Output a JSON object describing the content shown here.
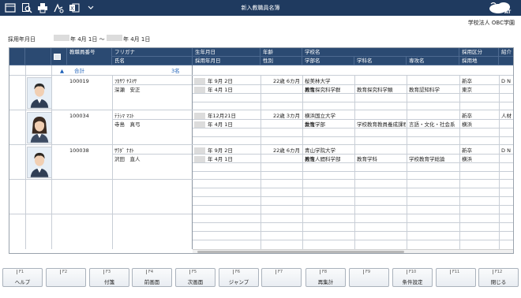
{
  "window": {
    "title": "新入教職員名簿",
    "company": "学校法人 OBC学園",
    "logo_text": "AT"
  },
  "toolbar": {
    "icons": [
      "window-icon",
      "search-icon",
      "printer-icon",
      "pdf-icon",
      "excel-icon",
      "dropdown-icon"
    ]
  },
  "filter": {
    "label": "採用年月日",
    "from_suffix": "年 4月 1日 ～",
    "to_suffix": "年 4月 1日"
  },
  "grid": {
    "headers_top": {
      "employee_no": "教職員番号",
      "furigana": "フリガナ",
      "birth": "生年月日",
      "age": "年齢",
      "school": "学校名",
      "hire_type": "採用区分",
      "intro": "紹介"
    },
    "headers_bottom": {
      "name": "氏名",
      "hire_date": "採用年月日",
      "gender": "性別",
      "faculty": "学部名",
      "department": "学科名",
      "major": "専攻名",
      "hire_place": "採用地"
    },
    "summary": {
      "label": "合計",
      "count": "3名"
    },
    "rows": [
      {
        "no": "100019",
        "kana": "ﾌｶｻﾜ ﾔｽﾏｻ",
        "name": "深瀬　安正",
        "birth": "年  9月  2日",
        "age": "22歳  6カ月",
        "school": "桜美林大学",
        "hire_type": "新卒",
        "intro": "D N",
        "hire_date": "年  4月  1日",
        "gender": "男性",
        "faculty": "教育探究科学群",
        "department": "教育探究科学類",
        "major": "教育認知科学",
        "place": "東京"
      },
      {
        "no": "100034",
        "kana": "ﾃﾗｼﾏ ﾏｺﾄ",
        "name": "寺島　真弓",
        "birth": "年12月21日",
        "age": "22歳  3カ月",
        "school": "横浜国立大学",
        "hire_type": "新卒",
        "intro": "人材",
        "hire_date": "年  4月  1日",
        "gender": "女性",
        "faculty": "教育学部",
        "department": "学校教育教員養成課程",
        "major": "言語・文化・社会系",
        "place": "横浜"
      },
      {
        "no": "100038",
        "kana": "ｻﾜﾀﾞ ﾅｵﾄ",
        "name": "沢田　直人",
        "birth": "年  9月  2日",
        "age": "22歳  6カ月",
        "school": "青山学院大学",
        "hire_type": "新卒",
        "intro": "D N",
        "hire_date": "年  4月  1日",
        "gender": "男性",
        "faculty": "教育人間科学部",
        "department": "教育学科",
        "major": "学校教育学総論",
        "place": "横浜"
      }
    ]
  },
  "fkeys": [
    {
      "key": "F1",
      "label": "ヘルプ"
    },
    {
      "key": "F2",
      "label": ""
    },
    {
      "key": "F3",
      "label": "付箋"
    },
    {
      "key": "F4",
      "label": "前画面"
    },
    {
      "key": "F5",
      "label": "次画面"
    },
    {
      "key": "F6",
      "label": "ジャンプ"
    },
    {
      "key": "F7",
      "label": ""
    },
    {
      "key": "F8",
      "label": "再集計"
    },
    {
      "key": "F9",
      "label": ""
    },
    {
      "key": "F10",
      "label": "条件設定"
    },
    {
      "key": "F11",
      "label": ""
    },
    {
      "key": "F12",
      "label": "閉じる"
    }
  ],
  "colors": {
    "titlebar": "#1f3a5f",
    "header": "#2b4a72",
    "summary_text": "#1b5fb8"
  }
}
